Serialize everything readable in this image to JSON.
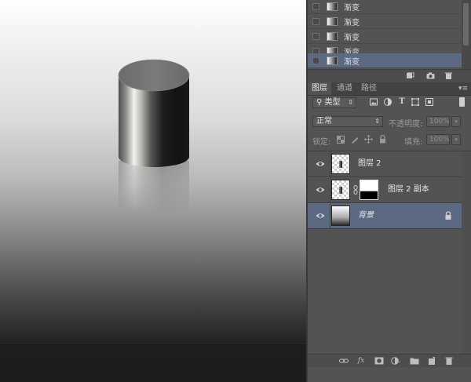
{
  "canvas": {
    "object": "metal-cylinder"
  },
  "history": {
    "items": [
      {
        "label": "渐变",
        "selected": false
      },
      {
        "label": "渐变",
        "selected": false
      },
      {
        "label": "渐变",
        "selected": false
      },
      {
        "label": "渐变",
        "selected": false
      },
      {
        "label": "渐变",
        "selected": true
      }
    ],
    "tool_icons": [
      "new-document-from-state-icon",
      "camera-icon",
      "trash-icon"
    ]
  },
  "layers_panel": {
    "tabs": [
      {
        "label": "图层",
        "active": true
      },
      {
        "label": "通道",
        "active": false
      },
      {
        "label": "路径",
        "active": false
      }
    ],
    "filter": {
      "kind_label": "类型",
      "icons": [
        "pixel-filter-icon",
        "adjustment-filter-icon",
        "type-filter-icon",
        "shape-filter-icon",
        "smart-object-filter-icon"
      ]
    },
    "blend_mode": "正常",
    "opacity_label": "不透明度:",
    "opacity_value": "100%",
    "lock_label": "锁定:",
    "fill_label": "填充:",
    "fill_value": "100%",
    "layers": [
      {
        "name": "图层 2",
        "visible": true,
        "has_mask": false,
        "selected": false,
        "locked": false,
        "italic": false
      },
      {
        "name": "图层 2 副本",
        "visible": true,
        "has_mask": true,
        "selected": false,
        "locked": false,
        "italic": false
      },
      {
        "name": "背景",
        "visible": true,
        "has_mask": false,
        "selected": true,
        "locked": true,
        "italic": true
      }
    ],
    "bottom_icons": [
      "link-layers-icon",
      "fx-icon",
      "add-mask-icon",
      "adjustment-layer-icon",
      "group-folder-icon",
      "new-layer-icon",
      "trash-icon"
    ]
  }
}
